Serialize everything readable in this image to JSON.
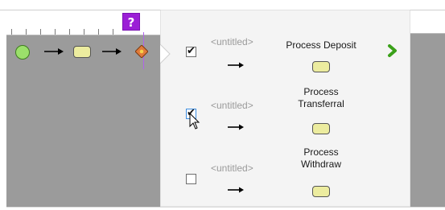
{
  "header": {
    "help_badge": "?"
  },
  "diagram": {
    "nodes": [
      {
        "type": "start-event",
        "color": "#9be06b"
      },
      {
        "type": "task",
        "color": "#ecec9f"
      },
      {
        "type": "exclusive-gateway",
        "color": "#e07a3a"
      }
    ]
  },
  "popup": {
    "rows": [
      {
        "checked": true,
        "untitled_label": "<untitled>",
        "task_label": "Process Deposit"
      },
      {
        "checked": true,
        "untitled_label": "<untitled>",
        "task_label": "Process Transferral",
        "task_label_line1": "Process",
        "task_label_line2": "Transferral"
      },
      {
        "checked": false,
        "untitled_label": "<untitled>",
        "task_label": "Process Withdraw",
        "task_label_line1": "Process",
        "task_label_line2": "Withdraw"
      }
    ],
    "next_icon": "chevron-right-icon",
    "next_color": "#3aa019"
  },
  "colors": {
    "canvas_gray": "#9b9b9b",
    "panel_bg": "#f4f4f4",
    "help_purple": "#9b1fd6"
  }
}
